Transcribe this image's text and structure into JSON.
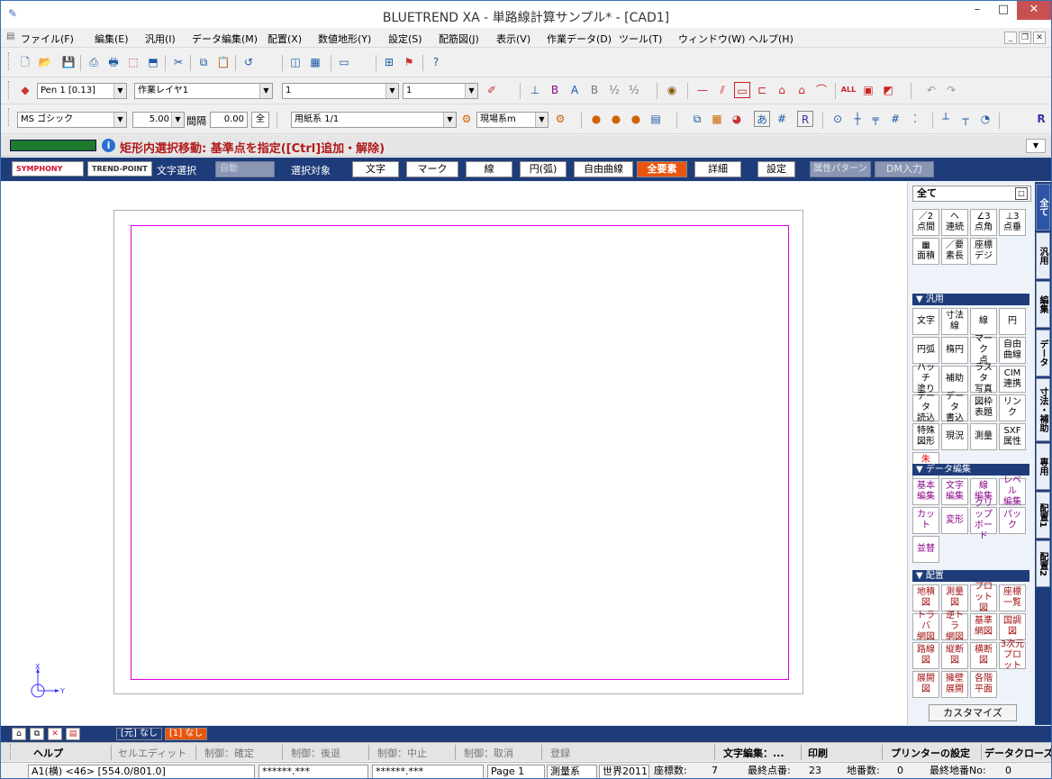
{
  "window": {
    "title": "BLUETREND XA - 単路線計算サンプル* - [CAD1]",
    "min": "–",
    "max": "□",
    "close": "✕"
  },
  "menu": {
    "items": [
      "ファイル(F)",
      "編集(E)",
      "汎用(I)",
      "データ編集(M)",
      "配置(X)",
      "数値地形(Y)",
      "設定(S)",
      "配筋図(J)",
      "表示(V)",
      "作業データ(D)",
      "ツール(T)",
      "ウィンドウ(W)",
      "ヘルプ(H)"
    ],
    "mdi_min": "_",
    "mdi_restore": "❐",
    "mdi_close": "✕"
  },
  "toolbar_pen": {
    "pen": "Pen 1 [0.13]",
    "layer": "作業レイヤ1",
    "linetype": "1",
    "linewidth": "1"
  },
  "toolbar_font": {
    "font": "MS ゴシック",
    "size": "5.00",
    "spacing_label": "間隔",
    "spacing": "0.00",
    "full_label": "全",
    "paper": "用紙系 1/1",
    "coord": "現場系m"
  },
  "instruction": {
    "message": "矩形内選択移動: 基準点を指定([Ctrl]追加・解除)"
  },
  "selection_bar": {
    "logo1": "SYMPHONY",
    "logo2": "TREND-POINT",
    "text_select_label": "文字選択",
    "mode": "自動",
    "target_label": "選択対象",
    "buttons": [
      "文字",
      "マーク",
      "線",
      "円(弧)",
      "自由曲線",
      "全要素",
      "詳細",
      "設定",
      "属性パターン",
      "DM入力"
    ]
  },
  "panel": {
    "header": "全て",
    "top_buttons": [
      "／2\n点間",
      "へ\n連続",
      "∠3\n点角",
      "⊥3\n点垂",
      "▦\n面積",
      "／要\n素長",
      "座標\nデジ"
    ],
    "section_general": "▼ 汎用",
    "general_buttons": [
      "文字",
      "寸法\n線",
      "線",
      "円",
      "円弧",
      "楕円",
      "マーク\n点",
      "自由\n曲線",
      "ハッチ\n塗り",
      "補助",
      "ラスタ\n写真",
      "CIM\n連携",
      "データ\n読込",
      "データ\n書込",
      "図枠\n表題",
      "リンク",
      "特殊\n図形",
      "現況",
      "測量",
      "SXF\n属性",
      "朱\n書き"
    ],
    "section_data": "▼ データ編集",
    "data_buttons": [
      "基本\n編集",
      "文字\n編集",
      "線\n編集",
      "レベル\n編集",
      "カット",
      "変形",
      "クリップ\nボード",
      "パック",
      "並替"
    ],
    "section_place": "▼ 配置",
    "place_buttons": [
      "地積\n図",
      "測量\n図",
      "プロット\n図",
      "座標\n一覧",
      "トラバ\n網図",
      "逆トラ\n網図",
      "基準\n網図",
      "国調\n図",
      "路線\n図",
      "縦断\n図",
      "横断\n図",
      "3次元\nプロット",
      "展開\n図",
      "擁壁\n展開",
      "各階\n平面"
    ],
    "customize": "カスタマイズ"
  },
  "tabs": [
    "全て",
    "汎用",
    "編集",
    "データ",
    "寸法・補助",
    "専用",
    "配置1",
    "配置2"
  ],
  "bottom": {
    "orig": "[元] なし",
    "layer": "[1] なし"
  },
  "fkeys": [
    "ヘルプ",
    "セルエディット",
    "制御：確定",
    "制御：後退",
    "制御：中止",
    "制御：取消",
    "登録",
    "文字編集：...",
    "印刷",
    "プリンターの設定",
    "データクローズ"
  ],
  "status": {
    "paper": "A1(横) <46> [554.0/801.0]",
    "x": "******.***",
    "y": "******.***",
    "page": "Page   1",
    "system": "測量系",
    "datum": "世界2011",
    "coord_count_label": "座標数:",
    "coord_count": "7",
    "last_point_label": "最終点番:",
    "last_point": "23",
    "lot_label": "地番数:",
    "lot": "0",
    "last_lot_label": "最終地番No:",
    "last_lot": "0"
  },
  "axes": {
    "x": "X",
    "y": "Y"
  }
}
